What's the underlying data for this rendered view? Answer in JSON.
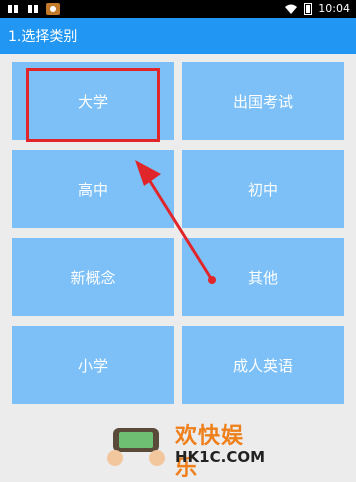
{
  "status": {
    "time": "10:04",
    "left_icons": [
      "notification-icon",
      "notification-icon",
      "app-icon"
    ]
  },
  "title": "1.选择类别",
  "categories": [
    {
      "label": "大学",
      "highlighted": true
    },
    {
      "label": "出国考试"
    },
    {
      "label": "高中"
    },
    {
      "label": "初中"
    },
    {
      "label": "新概念"
    },
    {
      "label": "其他"
    },
    {
      "label": "小学"
    },
    {
      "label": "成人英语"
    }
  ],
  "annotation": {
    "color": "#e0262b"
  },
  "watermark": {
    "brand": "欢快娱乐",
    "url": "HK1C.COM"
  },
  "colors": {
    "accent": "#2196f3",
    "tile": "#7cc0f7",
    "watermark": "#ef7f1a"
  }
}
